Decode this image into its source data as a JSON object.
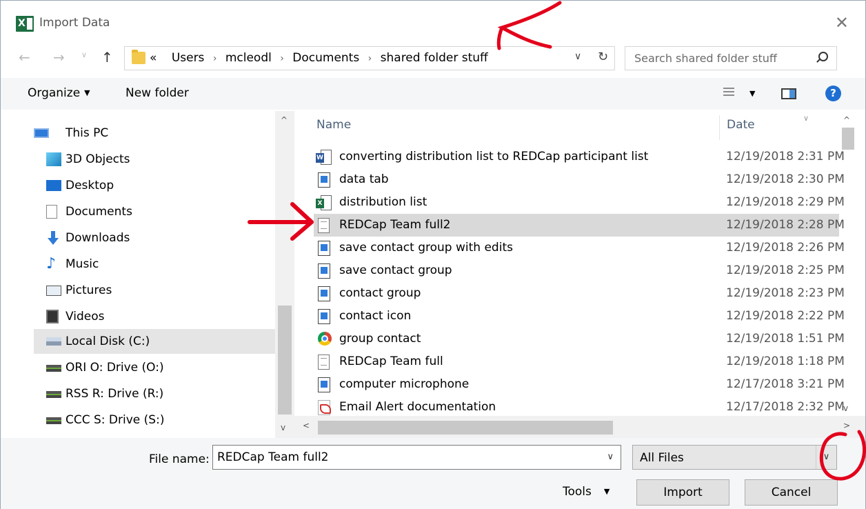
{
  "window": {
    "title": "Import Data",
    "app_icon": "excel-icon"
  },
  "address_bar": {
    "crumbs": [
      "«",
      "Users",
      "mcleodl",
      "Documents",
      "shared folder stuff"
    ],
    "search_placeholder": "Search shared folder stuff"
  },
  "toolbar": {
    "organize_label": "Organize",
    "new_folder_label": "New folder"
  },
  "nav_pane": {
    "items": [
      {
        "label": "This PC",
        "icon": "this-pc-icon"
      },
      {
        "label": "3D Objects",
        "icon": "3d-objects-icon"
      },
      {
        "label": "Desktop",
        "icon": "desktop-icon"
      },
      {
        "label": "Documents",
        "icon": "documents-icon"
      },
      {
        "label": "Downloads",
        "icon": "downloads-icon"
      },
      {
        "label": "Music",
        "icon": "music-icon"
      },
      {
        "label": "Pictures",
        "icon": "pictures-icon"
      },
      {
        "label": "Videos",
        "icon": "videos-icon"
      },
      {
        "label": "Local Disk (C:)",
        "icon": "local-disk-icon",
        "selected": true
      },
      {
        "label": "ORI O: Drive (O:)",
        "icon": "network-drive-icon"
      },
      {
        "label": "RSS R: Drive (R:)",
        "icon": "network-drive-icon"
      },
      {
        "label": "CCC S: Drive (S:)",
        "icon": "network-drive-icon"
      }
    ]
  },
  "file_list": {
    "columns": {
      "name": "Name",
      "date": "Date"
    },
    "rows": [
      {
        "name": "converting distribution list to REDCap participant list",
        "date": "12/19/2018 2:31 PM",
        "icon": "word-document-icon"
      },
      {
        "name": "data tab",
        "date": "12/19/2018 2:30 PM",
        "icon": "image-file-icon"
      },
      {
        "name": "distribution list",
        "date": "12/19/2018 2:29 PM",
        "icon": "excel-file-icon"
      },
      {
        "name": "REDCap Team full2",
        "date": "12/19/2018 2:28 PM",
        "icon": "text-file-icon",
        "selected": true
      },
      {
        "name": "save contact group with edits",
        "date": "12/19/2018 2:26 PM",
        "icon": "image-file-icon"
      },
      {
        "name": "save contact group",
        "date": "12/19/2018 2:25 PM",
        "icon": "image-file-icon"
      },
      {
        "name": "contact group",
        "date": "12/19/2018 2:23 PM",
        "icon": "image-file-icon"
      },
      {
        "name": "contact icon",
        "date": "12/19/2018 2:22 PM",
        "icon": "image-file-icon"
      },
      {
        "name": "group contact",
        "date": "12/19/2018 1:51 PM",
        "icon": "chrome-icon"
      },
      {
        "name": "REDCap Team full",
        "date": "12/19/2018 1:18 PM",
        "icon": "text-file-icon"
      },
      {
        "name": "computer microphone",
        "date": "12/17/2018 3:21 PM",
        "icon": "image-file-icon"
      },
      {
        "name": "Email Alert documentation",
        "date": "12/17/2018 2:32 PM",
        "icon": "pdf-file-icon"
      }
    ]
  },
  "bottom": {
    "file_name_label": "File name:",
    "file_name_value": "REDCap Team full2",
    "file_type_value": "All Files",
    "tools_label": "Tools",
    "import_label": "Import",
    "cancel_label": "Cancel"
  },
  "colors": {
    "annotation_red": "#e3001b",
    "selection_gray": "#d9d9d9",
    "accent_blue": "#1e6fd1"
  }
}
